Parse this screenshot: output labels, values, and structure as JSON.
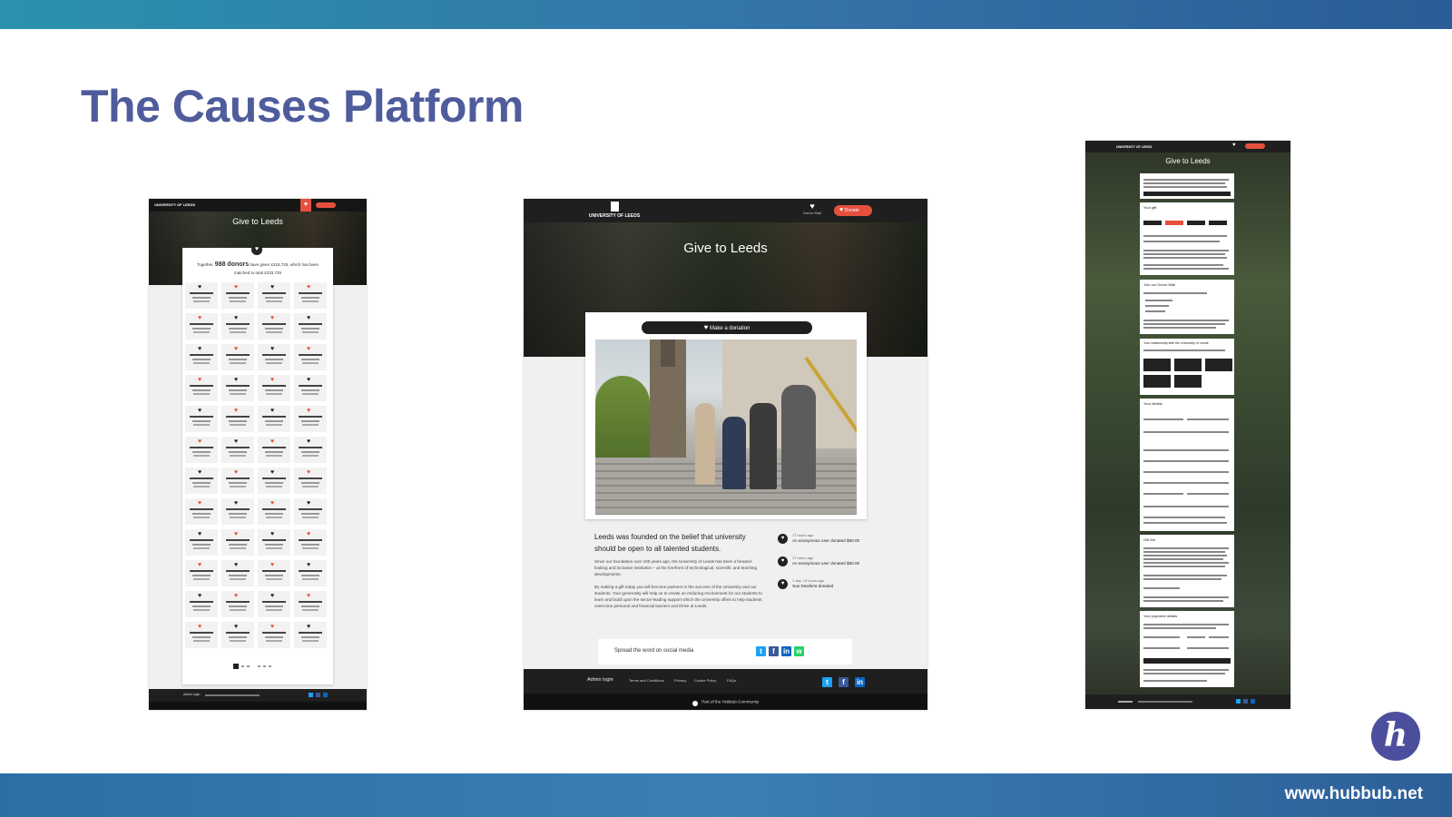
{
  "slide": {
    "title": "The Causes Platform",
    "url": "www.hubbub.net",
    "logo_letter": "h"
  },
  "shot_left": {
    "brand": "UNIVERSITY OF LEEDS",
    "hero_title": "Give to Leeds",
    "stats_text_1": "Together,",
    "donor_count": "988 donors",
    "stats_text_2": "have given £218,725, which has been",
    "stats_text_3": "matched to total £233,725",
    "footer_admin": "Admin login"
  },
  "shot_center": {
    "brand": "UNIVERSITY OF LEEDS",
    "donor_wall_label": "Donor Wall",
    "donate_label": "Donate",
    "hero_title": "Give to Leeds",
    "cta_label": "Make a donation",
    "headline": "Leeds was founded on the belief that university should be open to all talented students.",
    "para1": "Since our foundation over 100 years ago, the University of Leeds has been a forward-looking and inclusive institution – at the forefront of technological, scientific and teaching developments.",
    "para2": "By making a gift today you will become partners in the success of the University and our students. Your generosity will help us to create an enduring environment for our students to learn and build upon the sector-leading support which the University offers to help students overcome personal and financial barriers and thrive at Leeds.",
    "recent": [
      {
        "time": "17 hours ago",
        "text": "An anonymous user donated $50.00"
      },
      {
        "time": "17 hours ago",
        "text": "An anonymous user donated $50.00"
      },
      {
        "time": "1 day, 13 hours ago",
        "text": "Sue Dewhirst donated"
      }
    ],
    "share_label": "Spread the word on social media",
    "footer_links": [
      "Admin login",
      "Terms and Conditions",
      "Privacy",
      "Cookie Policy",
      "FAQs"
    ],
    "community": "Part of the Hubbub Community"
  },
  "shot_right": {
    "brand": "UNIVERSITY OF LEEDS",
    "hero_title": "Give to Leeds",
    "sections": [
      "Your gift",
      "Join our Donor Wall",
      "Your relationship with the University of Leeds",
      "Your details",
      "Gift Aid",
      "Your payment details"
    ]
  },
  "colors": {
    "accent_red": "#e5503f",
    "title_purple": "#4f5c9c",
    "dark_nav": "#1f1f1f"
  },
  "icons": {
    "heart": "heart-icon",
    "twitter": "twitter-icon",
    "facebook": "facebook-icon",
    "linkedin": "linkedin-icon",
    "whatsapp": "whatsapp-icon"
  }
}
